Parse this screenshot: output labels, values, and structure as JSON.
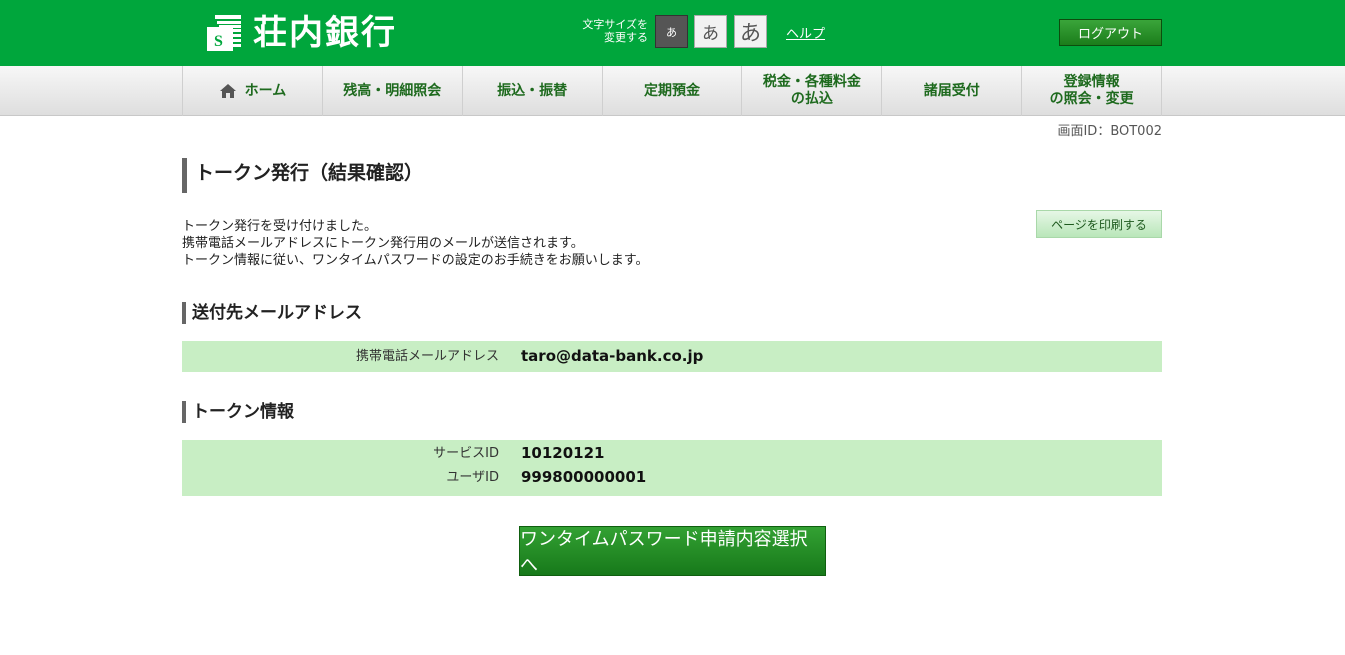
{
  "header": {
    "bank_name": "荘内銀行",
    "fontsize_label_1": "文字サイズを",
    "fontsize_label_2": "変更する",
    "fontsize_small": "あ",
    "fontsize_medium": "あ",
    "fontsize_large": "あ",
    "help": "ヘルプ",
    "logout": "ログアウト"
  },
  "nav": {
    "items": [
      {
        "label": "ホーム",
        "icon": "home-icon"
      },
      {
        "label": "残高・明細照会"
      },
      {
        "label": "振込・振替"
      },
      {
        "label": "定期預金"
      },
      {
        "label_1": "税金・各種料金",
        "label_2": "の払込"
      },
      {
        "label": "諸届受付"
      },
      {
        "label_1": "登録情報",
        "label_2": "の照会・変更"
      }
    ]
  },
  "screen_id": "画面ID：BOT002",
  "page_title": "トークン発行（結果確認）",
  "message": {
    "line1": "トークン発行を受け付けました。",
    "line2": "携帯電話メールアドレスにトークン発行用のメールが送信されます。",
    "line3": "トークン情報に従い、ワンタイムパスワードの設定のお手続きをお願いします。"
  },
  "print_button": "ページを印刷する",
  "mail_section": {
    "title": "送付先メールアドレス",
    "label": "携帯電話メールアドレス",
    "value": "taro@data-bank.co.jp"
  },
  "token_section": {
    "title": "トークン情報",
    "rows": [
      {
        "label": "サービスID",
        "value": "10120121"
      },
      {
        "label": "ユーザID",
        "value": "999800000001"
      }
    ]
  },
  "otp_button": "ワンタイムパスワード申請内容選択へ",
  "colors": {
    "brand_green": "#00a63c",
    "box_green": "#c8eec4",
    "nav_text": "#1e6a1e"
  }
}
